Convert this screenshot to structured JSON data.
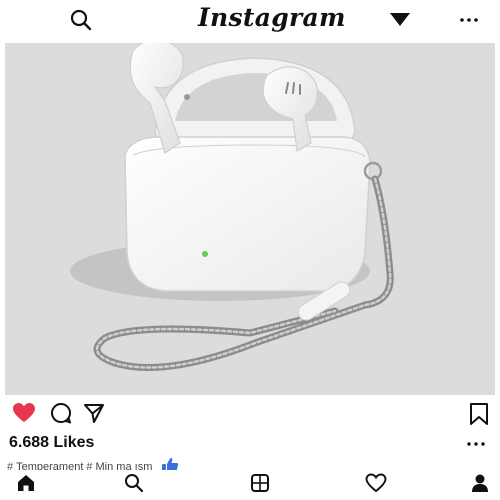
{
  "app": {
    "title": "Instagram",
    "icons": {
      "search": "search-icon",
      "dropdown": "caret-down-icon",
      "more": "more-icon"
    }
  },
  "post": {
    "image_description": "",
    "likes": "6.688 Likes",
    "liked": true,
    "caption": {
      "tags": [
        {
          "hash": "#",
          "text": "Temperament"
        },
        {
          "hash": "#",
          "text": "Min ma ısm"
        }
      ],
      "reaction": "thumbs-up-icon"
    }
  },
  "nav": {
    "items": [
      "home-icon",
      "search-icon",
      "reels-icon",
      "heart-icon",
      "profile-icon"
    ]
  },
  "colors": {
    "like": "#e8364f",
    "thumb": "#3b6fd8",
    "photo_bg": "#dcdcdc"
  }
}
